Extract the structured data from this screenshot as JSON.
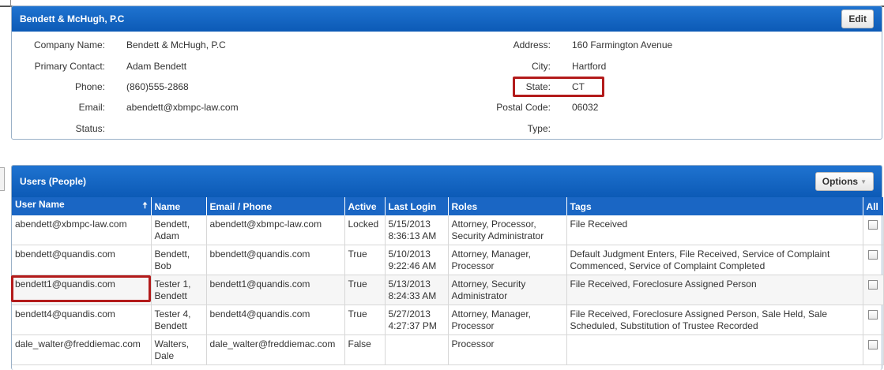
{
  "company": {
    "title": "Bendett & McHugh, P.C",
    "edit_label": "Edit",
    "left": [
      {
        "label": "Company Name:",
        "value": "Bendett & McHugh, P.C"
      },
      {
        "label": "Primary Contact:",
        "value": "Adam Bendett"
      },
      {
        "label": "Phone:",
        "value": "(860)555-2868"
      },
      {
        "label": "Email:",
        "value": "abendett@xbmpc-law.com"
      },
      {
        "label": "Status:",
        "value": ""
      }
    ],
    "right": [
      {
        "label": "Address:",
        "value": "160 Farmington Avenue"
      },
      {
        "label": "City:",
        "value": "Hartford"
      },
      {
        "label": "State:",
        "value": "CT"
      },
      {
        "label": "Postal Code:",
        "value": "06032"
      },
      {
        "label": "Type:",
        "value": ""
      }
    ]
  },
  "users": {
    "title": "Users (People)",
    "options_label": "Options",
    "columns": [
      "User Name",
      "Name",
      "Email / Phone",
      "Active",
      "Last Login",
      "Roles",
      "Tags",
      "All"
    ],
    "rows": [
      {
        "username": "abendett@xbmpc-law.com",
        "name1": "Bendett,",
        "name2": "Adam",
        "email": "abendett@xbmpc-law.com",
        "active": "Locked",
        "login1": "5/15/2013",
        "login2": "8:36:13 AM",
        "roles1": "Attorney, Processor,",
        "roles2": "Security Administrator",
        "tags1": "File Received",
        "tags2": ""
      },
      {
        "username": "bbendett@quandis.com",
        "name1": "Bendett,",
        "name2": "Bob",
        "email": "bbendett@quandis.com",
        "active": "True",
        "login1": "5/10/2013",
        "login2": "9:22:46 AM",
        "roles1": "Attorney, Manager,",
        "roles2": "Processor",
        "tags1": "Default Judgment Enters, File Received, Service of Complaint",
        "tags2": "Commenced, Service of Complaint Completed"
      },
      {
        "username": "bendett1@quandis.com",
        "name1": "Tester 1,",
        "name2": "Bendett",
        "email": "bendett1@quandis.com",
        "active": "True",
        "login1": "5/13/2013",
        "login2": "8:24:33 AM",
        "roles1": "Attorney, Security",
        "roles2": "Administrator",
        "tags1": "File Received, Foreclosure Assigned Person",
        "tags2": ""
      },
      {
        "username": "bendett4@quandis.com",
        "name1": "Tester 4,",
        "name2": "Bendett",
        "email": "bendett4@quandis.com",
        "active": "True",
        "login1": "5/27/2013",
        "login2": "4:27:37 PM",
        "roles1": "Attorney, Manager,",
        "roles2": "Processor",
        "tags1": "File Received, Foreclosure Assigned Person, Sale Held, Sale",
        "tags2": "Scheduled, Substitution of Trustee Recorded"
      },
      {
        "username": "dale_walter@freddiemac.com",
        "name1": "Walters,",
        "name2": "Dale",
        "email": "dale_walter@freddiemac.com",
        "active": "False",
        "login1": "",
        "login2": "",
        "roles1": "Processor",
        "roles2": "",
        "tags1": "",
        "tags2": ""
      }
    ]
  },
  "colors": {
    "header_blue": "#1a66c4",
    "highlight_red": "#b31b1b"
  }
}
